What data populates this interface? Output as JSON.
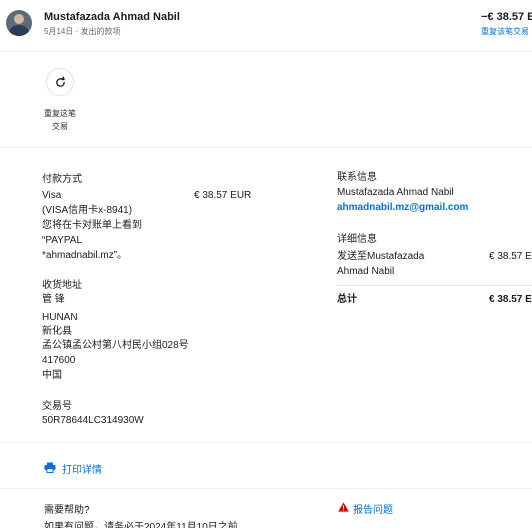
{
  "header": {
    "name": "Mustafazada Ahmad Nabil",
    "subline": "5月14日 · 发出的款项",
    "amount": "−€ 38.57 E",
    "repeat_link": "重复该笔交易"
  },
  "actions": {
    "repeat_label_line1": "重复这笔",
    "repeat_label_line2": "交易"
  },
  "payment": {
    "title": "付款方式",
    "method": "Visa",
    "amount": "€ 38.57 EUR",
    "card": "(VISA信用卡x-8941)",
    "statement_line1": "您将在卡对账单上看到",
    "statement_line2": "“PAYPAL",
    "statement_line3": "*ahmadnabil.mz”。"
  },
  "shipping": {
    "title": "收货地址",
    "name": "管 锋",
    "province": "HUNAN",
    "county": "新化县",
    "address": "孟公镇孟公村第八村民小组028号",
    "postal": "417600",
    "country": "中国"
  },
  "transaction": {
    "title": "交易号",
    "id": "50R78644LC314930W"
  },
  "contact": {
    "title": "联系信息",
    "name": "Mustafazada Ahmad Nabil",
    "email": "ahmadnabil.mz@gmail.com"
  },
  "detail_info": {
    "title": "详细信息",
    "sent_to_line1": "发送至Mustafazada",
    "sent_to_line2": "Ahmad Nabil",
    "sent_amount": "€ 38.57 E",
    "total_label": "总计",
    "total_amount": "€ 38.57 E"
  },
  "print": {
    "label": "打印详情"
  },
  "help": {
    "title": "需要帮助?",
    "text": "如果有问题，请务必于2024年11月10日之前",
    "report_label": "报告问题"
  },
  "colors": {
    "link": "#0070e0",
    "warning": "#d20000"
  }
}
